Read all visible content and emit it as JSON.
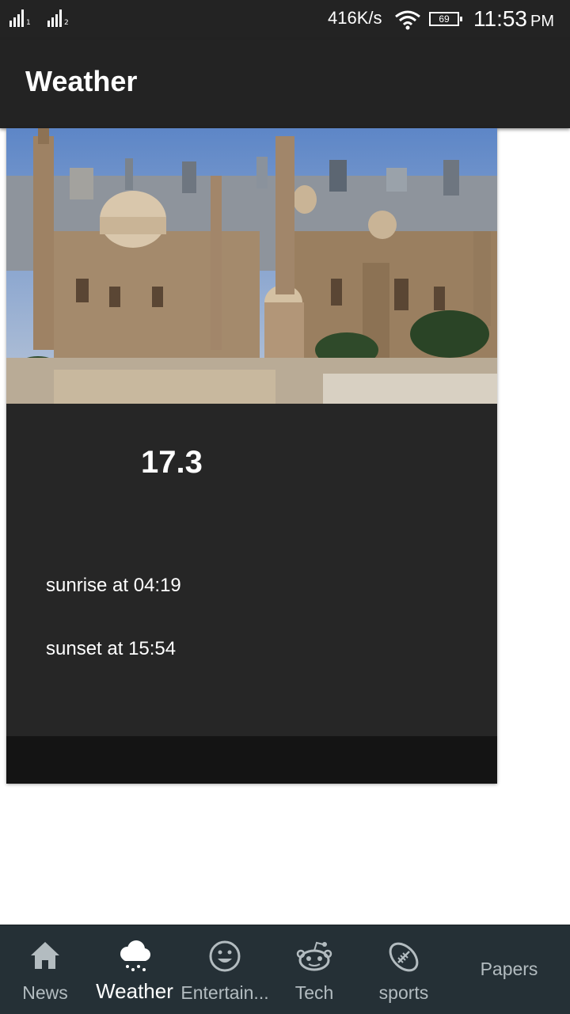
{
  "status_bar": {
    "net_speed": "416K/s",
    "battery": "69",
    "time": "11:53",
    "ampm": "PM",
    "sim1": "1",
    "sim2": "2"
  },
  "app_bar": {
    "title": "Weather"
  },
  "weather": {
    "temperature": "17.3",
    "sunrise": "sunrise at 04:19",
    "sunset": "sunset at 15:54"
  },
  "bottom_nav": {
    "items": [
      {
        "label": "News",
        "icon": "home-icon"
      },
      {
        "label": "Weather",
        "icon": "rain-cloud-icon"
      },
      {
        "label": "Entertain...",
        "icon": "smiley-icon"
      },
      {
        "label": "Tech",
        "icon": "reddit-alien-icon"
      },
      {
        "label": "sports",
        "icon": "football-icon"
      },
      {
        "label": "Papers",
        "icon": ""
      }
    ],
    "active": "Weather"
  },
  "colors": {
    "status_bar": "#232323",
    "card": "#262626",
    "nav_bg": "#253036",
    "nav_text": "#b3bcc0"
  }
}
